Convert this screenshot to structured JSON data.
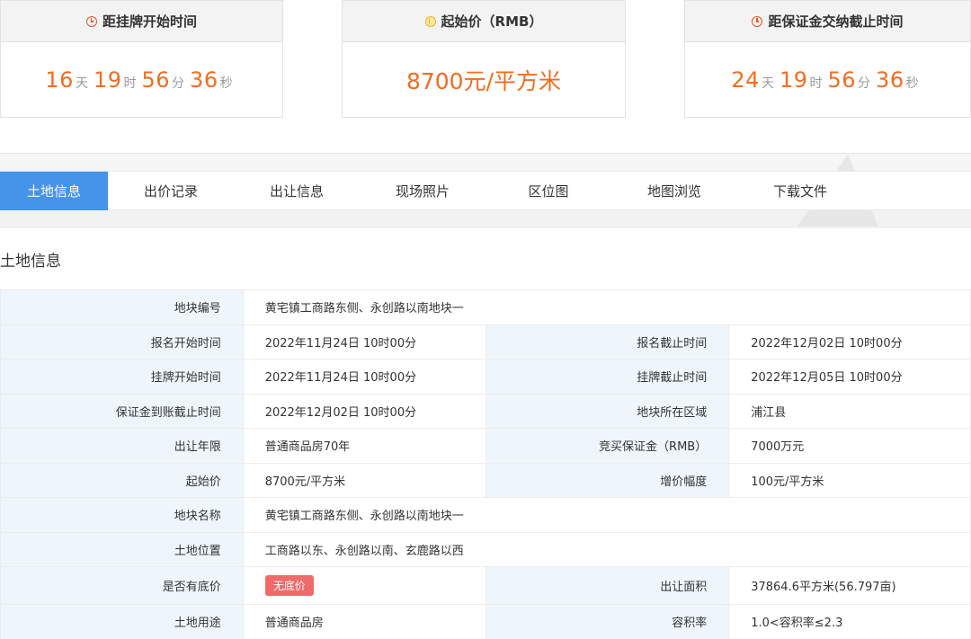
{
  "countdown_cards": [
    {
      "title": "距挂牌开始时间",
      "icon": "clock-icon",
      "days": "16",
      "day_unit": "天",
      "hours": "19",
      "hour_unit": "时",
      "minutes": "56",
      "minute_unit": "分",
      "seconds": "36",
      "second_unit": "秒"
    },
    {
      "title": "起始价（RMB）",
      "icon": "coin-icon",
      "value": "8700元/平方米"
    },
    {
      "title": "距保证金交纳截止时间",
      "icon": "clock-icon",
      "days": "24",
      "day_unit": "天",
      "hours": "19",
      "hour_unit": "时",
      "minutes": "56",
      "minute_unit": "分",
      "seconds": "36",
      "second_unit": "秒"
    }
  ],
  "tabs": [
    {
      "label": "土地信息",
      "active": true
    },
    {
      "label": "出价记录"
    },
    {
      "label": "出让信息"
    },
    {
      "label": "现场照片"
    },
    {
      "label": "区位图"
    },
    {
      "label": "地图浏览"
    },
    {
      "label": "下载文件"
    }
  ],
  "section_title": "土地信息",
  "info": {
    "r0": {
      "k1": "地块编号",
      "v1": "黄宅镇工商路东侧、永创路以南地块一"
    },
    "r1": {
      "k1": "报名开始时间",
      "v1": "2022年11月24日 10时00分",
      "k2": "报名截止时间",
      "v2": "2022年12月02日 10时00分"
    },
    "r2": {
      "k1": "挂牌开始时间",
      "v1": "2022年11月24日 10时00分",
      "k2": "挂牌截止时间",
      "v2": "2022年12月05日 10时00分"
    },
    "r3": {
      "k1": "保证金到账截止时间",
      "v1": "2022年12月02日 10时00分",
      "k2": "地块所在区域",
      "v2": "浦江县"
    },
    "r4": {
      "k1": "出让年限",
      "v1": "普通商品房70年",
      "k2": "竞买保证金（RMB）",
      "v2": "7000万元"
    },
    "r5": {
      "k1": "起始价",
      "v1": "8700元/平方米",
      "k2": "增价幅度",
      "v2": "100元/平方米"
    },
    "r6": {
      "k1": "地块名称",
      "v1": "黄宅镇工商路东侧、永创路以南地块一"
    },
    "r7": {
      "k1": "土地位置",
      "v1": "工商路以东、永创路以南、玄鹿路以西"
    },
    "r8": {
      "k1": "是否有底价",
      "badge": "无底价",
      "k2": "出让面积",
      "v2": "37864.6平方米(56.797亩)"
    },
    "r9": {
      "k1": "土地用途",
      "v1": "普通商品房",
      "k2": "容积率",
      "v2": "1.0<容积率≤2.3"
    }
  },
  "colors": {
    "accent_blue": "#4693ea",
    "countdown_orange": "#f26d21",
    "key_cell_bg": "#eef6fb",
    "badge_red": "#f16a6a"
  }
}
